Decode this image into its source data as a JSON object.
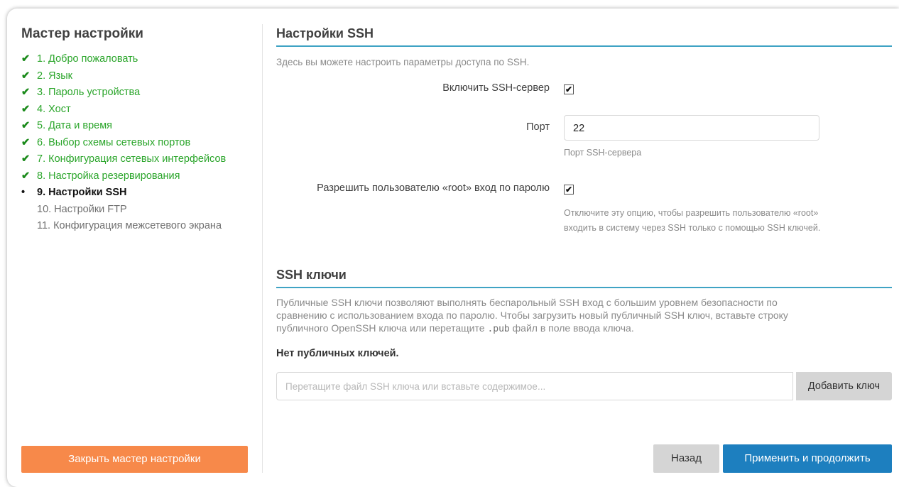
{
  "sidebar": {
    "title": "Мастер настройки",
    "steps": [
      {
        "label": "1. Добро пожаловать",
        "state": "done"
      },
      {
        "label": "2. Язык",
        "state": "done"
      },
      {
        "label": "3. Пароль устройства",
        "state": "done"
      },
      {
        "label": "4. Хост",
        "state": "done"
      },
      {
        "label": "5. Дата и время",
        "state": "done"
      },
      {
        "label": "6. Выбор схемы сетевых портов",
        "state": "done"
      },
      {
        "label": "7. Конфигурация сетевых интерфейсов",
        "state": "done"
      },
      {
        "label": "8. Настройка резервирования",
        "state": "done"
      },
      {
        "label": "9. Настройки SSH",
        "state": "active"
      },
      {
        "label": "10. Настройки FTP",
        "state": "todo"
      },
      {
        "label": "11. Конфигурация межсетевого экрана",
        "state": "todo"
      }
    ],
    "done_mark": "✔",
    "active_mark": "•",
    "close_label": "Закрыть мастер настройки"
  },
  "ssh_settings": {
    "title": "Настройки SSH",
    "description": "Здесь вы можете настроить параметры доступа по SSH.",
    "enable_label": "Включить SSH-сервер",
    "enable_checked": true,
    "port_label": "Порт",
    "port_value": "22",
    "port_help": "Порт SSH-сервера",
    "root_label": "Разрешить пользователю «root» вход по паролю",
    "root_checked": true,
    "root_help_line1": "Отключите эту опцию, чтобы разрешить пользователю «root»",
    "root_help_line2": "входить в систему через SSH только с помощью SSH ключей.",
    "check_glyph": "✔"
  },
  "ssh_keys": {
    "title": "SSH ключи",
    "desc_line1": "Публичные SSH ключи позволяют выполнять беспарольный SSH вход с большим уровнем безопасности по",
    "desc_line2": "сравнению с использованием входа по паролю. Чтобы загрузить новый публичный SSH ключ, вставьте строку",
    "desc_line3_prefix": "публичного OpenSSH ключа или перетащите ",
    "desc_line3_code": ".pub",
    "desc_line3_suffix": " файл в поле ввода ключа.",
    "no_keys": "Нет публичных ключей.",
    "input_placeholder": "Перетащите файл SSH ключа или вставьте содержимое...",
    "add_label": "Добавить ключ"
  },
  "footer": {
    "back_label": "Назад",
    "apply_label": "Применить и продолжить"
  },
  "colors": {
    "done": "#2aa52a",
    "accent_rule": "#3fa3c4",
    "close_button": "#f7894a",
    "apply_button": "#1d7fbf",
    "secondary_button": "#d5d5d5"
  }
}
